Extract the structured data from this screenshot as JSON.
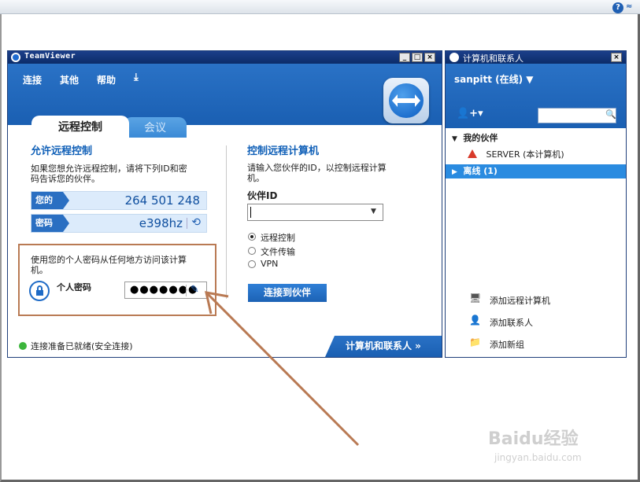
{
  "main_window": {
    "title": "TeamViewer",
    "window_controls": [
      "_",
      "□",
      "×"
    ],
    "menu": [
      "连接",
      "其他",
      "帮助"
    ],
    "tabs": [
      "远程控制",
      "会议"
    ],
    "allow": {
      "title": "允许远程控制",
      "desc_line1": "如果您想允许远程控制，请将下列ID和密",
      "desc_line2": "码告诉您的伙伴。",
      "id_label": "您的ID",
      "id_value": "264 501 248",
      "pw_label": "密码",
      "pw_value": "e398hz"
    },
    "personal": {
      "desc_line1": "使用您的个人密码从任何地方访问该计算",
      "desc_line2": "机。",
      "label": "个人密码",
      "value": "●●●●●●●"
    },
    "control": {
      "title": "控制远程计算机",
      "desc_line1": "请输入您伙伴的ID，以控制远程计算",
      "desc_line2": "机。",
      "partner_id_label": "伙伴ID",
      "partner_id_value": "",
      "options": [
        "远程控制",
        "文件传输",
        "VPN"
      ],
      "selected_option": "远程控制",
      "connect_button": "连接到伙伴"
    },
    "status_text": "连接准备已就绪(安全连接)",
    "contacts_button": "计算机和联系人 »"
  },
  "contacts_panel": {
    "title": "计算机和联系人",
    "user": "sanpitt (在线) ▼",
    "groups": [
      {
        "name": "我的伙伴",
        "expanded": true,
        "items": [
          "SERVER (本计算机)"
        ]
      },
      {
        "name": "离线 (1)",
        "expanded": false,
        "items": []
      }
    ],
    "actions": [
      "添加远程计算机",
      "添加联系人",
      "添加新组"
    ]
  },
  "watermark": {
    "brand": "Baidu经验",
    "url": "jingyan.baidu.com"
  },
  "colors": {
    "accent": "#1a5fb2",
    "annotation": "#b97a54",
    "online": "#3cb53c"
  }
}
